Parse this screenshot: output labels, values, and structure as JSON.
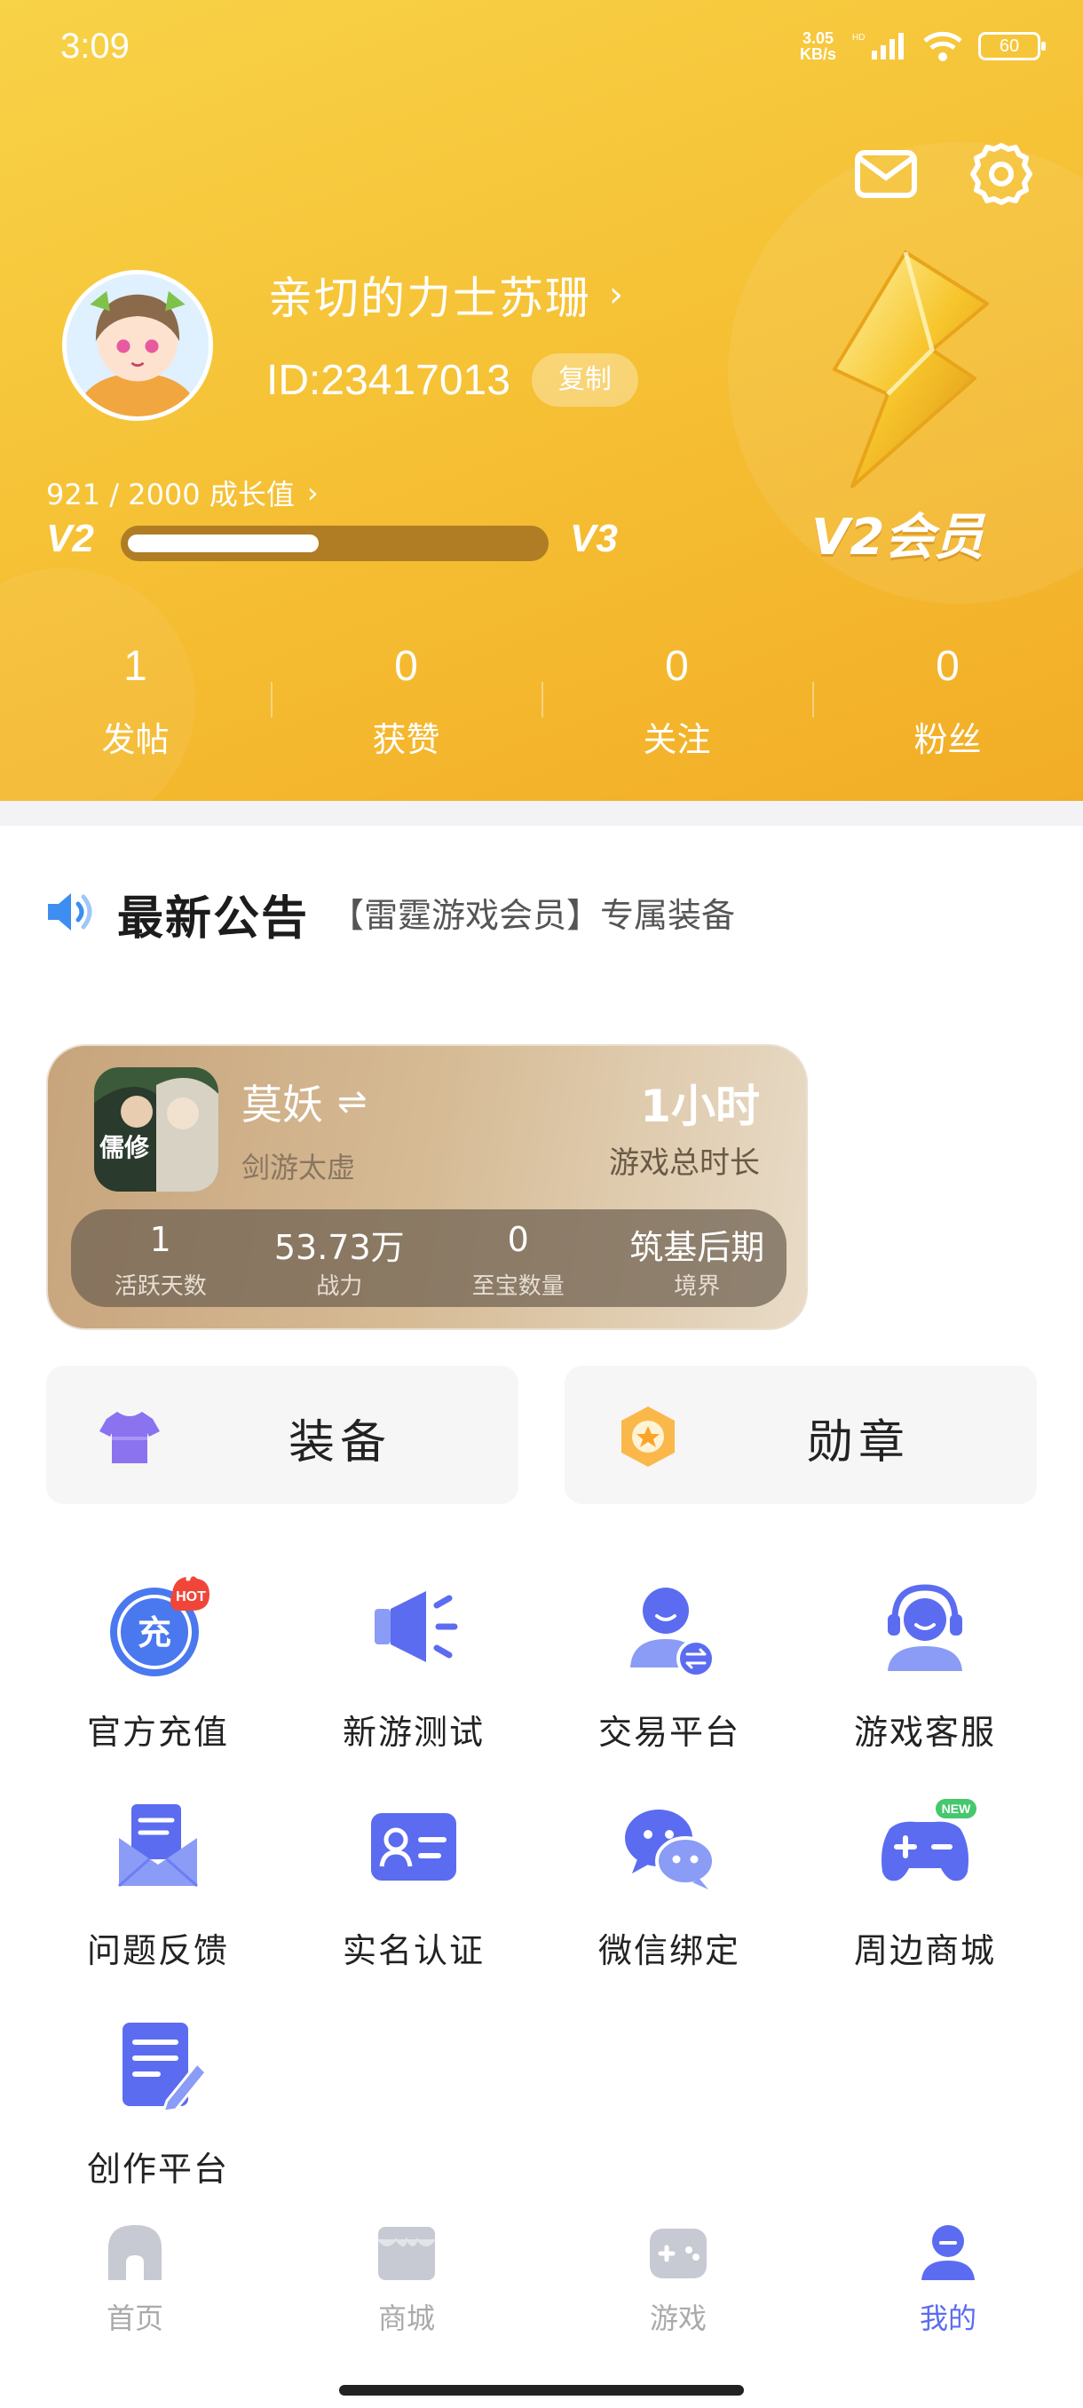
{
  "status_bar": {
    "time": "3:09",
    "net_speed_value": "3.05",
    "net_speed_unit": "KB/s",
    "network": "HD",
    "battery": "60"
  },
  "header": {
    "username": "亲切的力士苏珊",
    "user_id": "ID:23417013",
    "copy_label": "复制",
    "growth_text": "921 / 2000 成长值",
    "growth_current": 921,
    "growth_max": 2000,
    "level_current": "V2",
    "level_next": "V3",
    "vip_label": "V2会员",
    "icons": [
      "mail-icon",
      "gear-icon",
      "chevron-right-icon"
    ]
  },
  "stats": [
    {
      "value": "1",
      "label": "发帖"
    },
    {
      "value": "0",
      "label": "获赞"
    },
    {
      "value": "0",
      "label": "关注"
    },
    {
      "value": "0",
      "label": "粉丝"
    }
  ],
  "notice": {
    "title": "最新公告",
    "text": "【雷霆游戏会员】专属装备",
    "icon": "speaker-icon"
  },
  "game_card": {
    "name": "莫妖",
    "server": "剑游太虚",
    "playtime": "1小时",
    "playtime_label": "游戏总时长",
    "cover_text": "儒修",
    "stats": [
      {
        "value": "1",
        "label": "活跃天数"
      },
      {
        "value": "53.73万",
        "label": "战力"
      },
      {
        "value": "0",
        "label": "至宝数量"
      },
      {
        "value": "筑基后期",
        "label": "境界"
      }
    ]
  },
  "quick_buttons": {
    "equip": "装备",
    "medal": "勋章"
  },
  "services": [
    {
      "label": "官方充值",
      "icon": "recharge-icon",
      "badge": "HOT",
      "glyph": "充"
    },
    {
      "label": "新游测试",
      "icon": "megaphone-icon"
    },
    {
      "label": "交易平台",
      "icon": "trade-user-icon"
    },
    {
      "label": "游戏客服",
      "icon": "headset-icon"
    },
    {
      "label": "问题反馈",
      "icon": "feedback-icon"
    },
    {
      "label": "实名认证",
      "icon": "id-card-icon"
    },
    {
      "label": "微信绑定",
      "icon": "wechat-icon"
    },
    {
      "label": "周边商城",
      "icon": "gamepad-icon",
      "badge": "NEW"
    },
    {
      "label": "创作平台",
      "icon": "edit-doc-icon"
    }
  ],
  "bottom_nav": [
    {
      "label": "首页",
      "icon": "home-icon"
    },
    {
      "label": "商城",
      "icon": "store-icon"
    },
    {
      "label": "游戏",
      "icon": "game-icon"
    },
    {
      "label": "我的",
      "icon": "profile-icon",
      "active": true
    }
  ],
  "colors": {
    "header_gold": "#f6c236",
    "accent": "#5b6cf0",
    "text_dark": "#222222"
  }
}
